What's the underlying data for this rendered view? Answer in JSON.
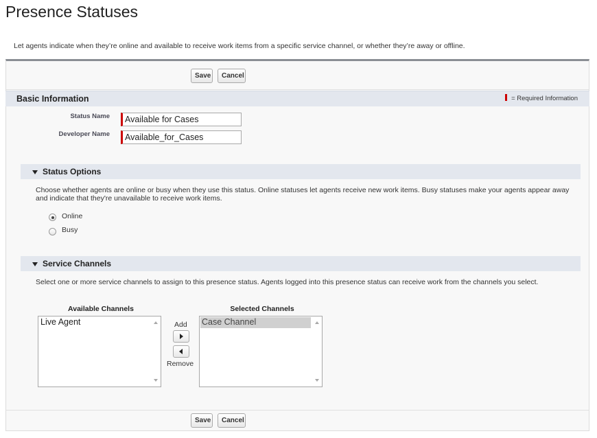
{
  "page": {
    "title": "Presence Statuses",
    "description": "Let agents indicate when they’re online and available to receive work items from a specific service channel, or whether they’re away or offline."
  },
  "buttons": {
    "save": "Save",
    "cancel": "Cancel"
  },
  "basic_info": {
    "title": "Basic Information",
    "required_legend": "= Required Information",
    "status_name_label": "Status Name",
    "status_name_value": "Available for Cases",
    "developer_name_label": "Developer Name",
    "developer_name_value": "Available_for_Cases"
  },
  "status_options": {
    "title": "Status Options",
    "description": "Choose whether agents are online or busy when they use this status. Online statuses let agents receive new work items. Busy statuses make your agents appear away and indicate that they're unavailable to receive work items.",
    "options": [
      {
        "label": "Online",
        "checked": true
      },
      {
        "label": "Busy",
        "checked": false
      }
    ]
  },
  "service_channels": {
    "title": "Service Channels",
    "description": "Select one or more service channels to assign to this presence status. Agents logged into this presence status can receive work from the channels you select.",
    "available_label": "Available Channels",
    "available_items": [
      "Live Agent"
    ],
    "selected_label": "Selected Channels",
    "selected_items": [
      "Case Channel"
    ],
    "add_label": "Add",
    "remove_label": "Remove"
  },
  "colors": {
    "required": "#cc0000",
    "section_bg": "#e3e7ee",
    "panel_border_top": "#8a8e94"
  }
}
